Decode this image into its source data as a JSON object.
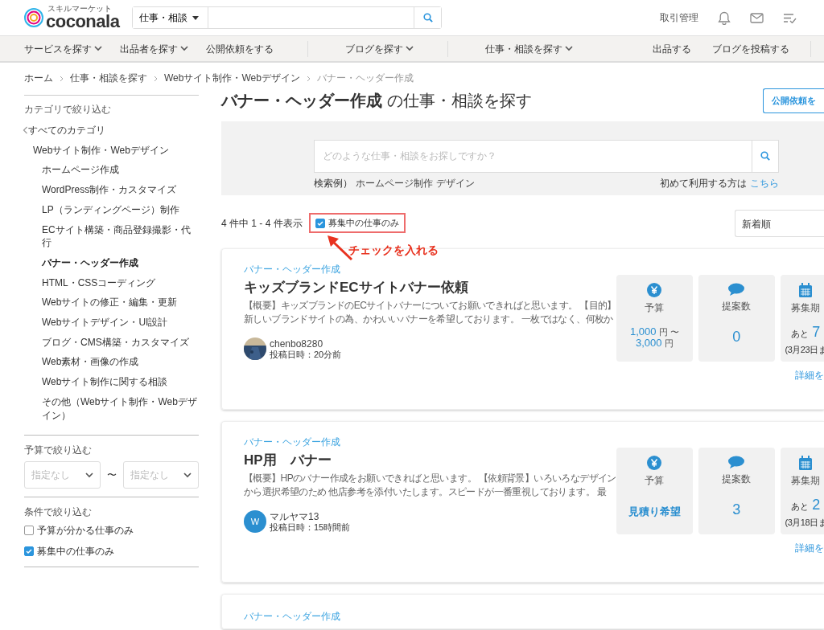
{
  "header": {
    "logo_tagline": "スキルマーケット",
    "logo": "coconala",
    "search_scope": "仕事・相談",
    "links": [
      "取引管理"
    ]
  },
  "nav": {
    "left": [
      {
        "label": "サービスを探す",
        "dropdown": true
      },
      {
        "label": "出品者を探す",
        "dropdown": true
      },
      {
        "label": "公開依頼をする",
        "dropdown": false
      },
      {
        "label": "ブログを探す",
        "dropdown": true
      },
      {
        "label": "仕事・相談を探す",
        "dropdown": true
      }
    ],
    "right": [
      "出品する",
      "ブログを投稿する"
    ]
  },
  "breadcrumb": [
    {
      "label": "ホーム",
      "current": false
    },
    {
      "label": "仕事・相談を探す",
      "current": false
    },
    {
      "label": "Webサイト制作・Webデザイン",
      "current": false
    },
    {
      "label": "バナー・ヘッダー作成",
      "current": true
    }
  ],
  "sidebar": {
    "category_heading": "カテゴリで絞り込む",
    "categories": [
      {
        "label": "すべてのカテゴリ",
        "selected": false,
        "children": [
          {
            "label": "Webサイト制作・Webデザイン",
            "selected": false,
            "children": [
              {
                "label": "ホームページ作成",
                "selected": false
              },
              {
                "label": "WordPress制作・カスタマイズ",
                "selected": false
              },
              {
                "label": "LP（ランディングページ）制作",
                "selected": false
              },
              {
                "label": "ECサイト構築・商品登録撮影・代行",
                "selected": false
              },
              {
                "label": "バナー・ヘッダー作成",
                "selected": true
              },
              {
                "label": "HTML・CSSコーディング",
                "selected": false
              },
              {
                "label": "Webサイトの修正・編集・更新",
                "selected": false
              },
              {
                "label": "Webサイトデザイン・UI設計",
                "selected": false
              },
              {
                "label": "ブログ・CMS構築・カスタマイズ",
                "selected": false
              },
              {
                "label": "Web素材・画像の作成",
                "selected": false
              },
              {
                "label": "Webサイト制作に関する相談",
                "selected": false
              },
              {
                "label": "その他（Webサイト制作・Webデザイン）",
                "selected": false
              }
            ]
          }
        ]
      }
    ],
    "budget_heading": "予算で絞り込む",
    "budget_min": {
      "placeholder": "指定なし"
    },
    "budget_separator": "〜",
    "budget_max": {
      "placeholder": "指定なし"
    },
    "conditions_heading": "条件で絞り込む",
    "conditions": [
      {
        "label": "予算が分かる仕事のみ",
        "checked": false
      },
      {
        "label": "募集中の仕事のみ",
        "checked": true
      }
    ]
  },
  "main": {
    "title_bold": "バナー・ヘッダー作成",
    "title_rest": "の仕事・相談を探す",
    "post_button": "公開依頼を",
    "search": {
      "placeholder": "どのような仕事・相談をお探しですか？",
      "examples_label": "検索例）",
      "examples": [
        "ホームページ制作",
        "デザイン"
      ],
      "first_time": "初めて利用する方は",
      "first_time_link": "こちら"
    },
    "result_count": "4 件中 1 - 4 件表示",
    "open_only": {
      "label": "募集中の仕事のみ",
      "checked": true
    },
    "sort": "新着順",
    "annotation": {
      "label": "チェックを入れる"
    }
  },
  "jobs": [
    {
      "category": "バナー・ヘッダー作成",
      "title": "キッズブランドECサイトバナー依頼",
      "summary_lines": [
        "【概要】キッズブランドのECサイトバナーについてお願いできればと思います。 【目的】",
        "新しいブランドサイトの為、かわいいバナーを希望しております。 一枚ではなく、何枚か"
      ],
      "user": "chenbo8280",
      "avatar": {
        "kind": "picture"
      },
      "posted": "投稿日時：20分前",
      "budget_label": "予算",
      "budget": {
        "kind": "range",
        "parts": [
          {
            "amount": "1,000",
            "unit": "円 〜"
          },
          {
            "amount": "3,000",
            "unit": "円"
          }
        ]
      },
      "proposals_label": "提案数",
      "proposals": "0",
      "deadline_label": "募集期",
      "deadline_prefix": "あと",
      "deadline_days": "7",
      "deadline_date": "(3月23日ま",
      "details": "詳細を"
    },
    {
      "category": "バナー・ヘッダー作成",
      "title": "HP用　バナー",
      "summary_lines": [
        "【概要】HPのバナー作成をお願いできればと思います。 【依頼背景】いろいろなデザイン",
        "から選択希望のため 他店参考を添付いたします。スピードが一番重視しております。 最"
      ],
      "user": "マルヤマ13",
      "avatar": {
        "kind": "initial",
        "text": "W"
      },
      "posted": "投稿日時：15時間前",
      "budget_label": "予算",
      "budget": {
        "kind": "estimate",
        "text": "見積り希望"
      },
      "proposals_label": "提案数",
      "proposals": "3",
      "deadline_label": "募集期",
      "deadline_prefix": "あと",
      "deadline_days": "2",
      "deadline_date": "(3月18日ま",
      "details": "詳細を"
    },
    {
      "category": "バナー・ヘッダー作成"
    }
  ]
}
